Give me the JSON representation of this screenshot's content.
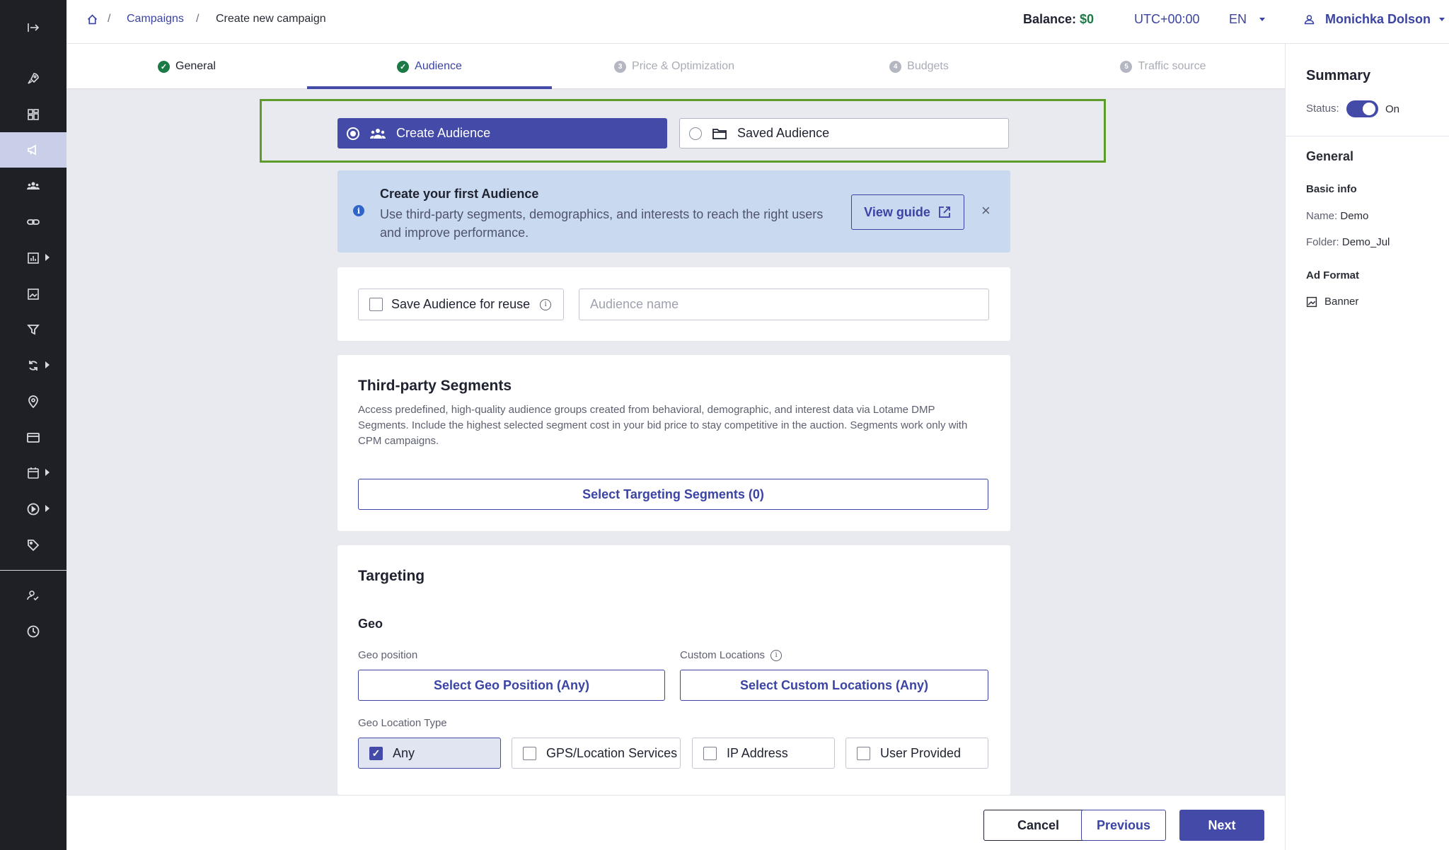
{
  "sidebar": {
    "items": [
      {
        "name": "collapse-icon"
      },
      {
        "name": "rocket-icon"
      },
      {
        "name": "dashboard-icon"
      },
      {
        "name": "megaphone-icon"
      },
      {
        "name": "users-icon"
      },
      {
        "name": "link-icon"
      },
      {
        "name": "chart-icon"
      },
      {
        "name": "image-icon"
      },
      {
        "name": "filter-icon"
      },
      {
        "name": "sync-icon"
      },
      {
        "name": "location-pin-icon"
      },
      {
        "name": "credit-card-icon"
      },
      {
        "name": "calendar-icon"
      },
      {
        "name": "play-icon"
      },
      {
        "name": "tag-icon"
      },
      {
        "name": "user-check-icon"
      },
      {
        "name": "clock-icon"
      }
    ]
  },
  "breadcrumb": {
    "home_icon": "home-icon",
    "sep": "/",
    "campaigns": "Campaigns",
    "current": "Create new campaign"
  },
  "topbar": {
    "balance_label": "Balance:",
    "balance_value": "$0",
    "timezone": "UTC+00:00",
    "language": "EN",
    "user_name": "Monichka Dolson"
  },
  "steps": [
    {
      "label": "General",
      "num": "",
      "state": "done"
    },
    {
      "label": "Audience",
      "num": "",
      "state": "active"
    },
    {
      "label": "Price & Optimization",
      "num": "3",
      "state": "pending"
    },
    {
      "label": "Budgets",
      "num": "4",
      "state": "pending"
    },
    {
      "label": "Traffic source",
      "num": "5",
      "state": "pending"
    }
  ],
  "audience_mode": {
    "create_label": "Create Audience",
    "saved_label": "Saved Audience",
    "selected": "create"
  },
  "info_banner": {
    "title": "Create your first Audience",
    "description": "Use third-party segments, demographics, and interests to reach the right users and improve performance.",
    "guide_button": "View guide",
    "close": "×"
  },
  "save_audience": {
    "checkbox_label": "Save Audience for reuse",
    "checked": false,
    "name_placeholder": "Audience name",
    "name_value": ""
  },
  "segments": {
    "title": "Third-party Segments",
    "description": "Access predefined, high-quality audience groups created from behavioral, demographic, and interest data via Lotame DMP Segments. Include the highest selected segment cost in your bid price to stay competitive in the auction. Segments work only with CPM campaigns.",
    "button": "Select Targeting Segments (0)"
  },
  "targeting": {
    "title": "Targeting",
    "geo_title": "Geo",
    "geo_position_label": "Geo position",
    "geo_position_button": "Select Geo Position (Any)",
    "custom_locations_label": "Custom Locations",
    "custom_locations_button": "Select Custom Locations (Any)",
    "location_type_label": "Geo Location Type",
    "location_types": [
      {
        "label": "Any",
        "checked": true
      },
      {
        "label": "GPS/Location Services",
        "checked": false
      },
      {
        "label": "IP Address",
        "checked": false
      },
      {
        "label": "User Provided",
        "checked": false
      }
    ]
  },
  "summary": {
    "title": "Summary",
    "status_label": "Status:",
    "status_value": "On",
    "status_on": true,
    "general_title": "General",
    "basic_info_title": "Basic info",
    "name_label": "Name:",
    "name_value": "Demo",
    "folder_label": "Folder:",
    "folder_value": "Demo_Jul",
    "ad_format_title": "Ad Format",
    "ad_format_value": "Banner"
  },
  "footer": {
    "cancel": "Cancel",
    "previous": "Previous",
    "next": "Next"
  },
  "colors": {
    "accent": "#434aa8",
    "sidebar_bg": "#1f2026",
    "success": "#1c7a46",
    "highlight_frame": "#5d9b2a",
    "info_bg": "#c9d9f0"
  }
}
